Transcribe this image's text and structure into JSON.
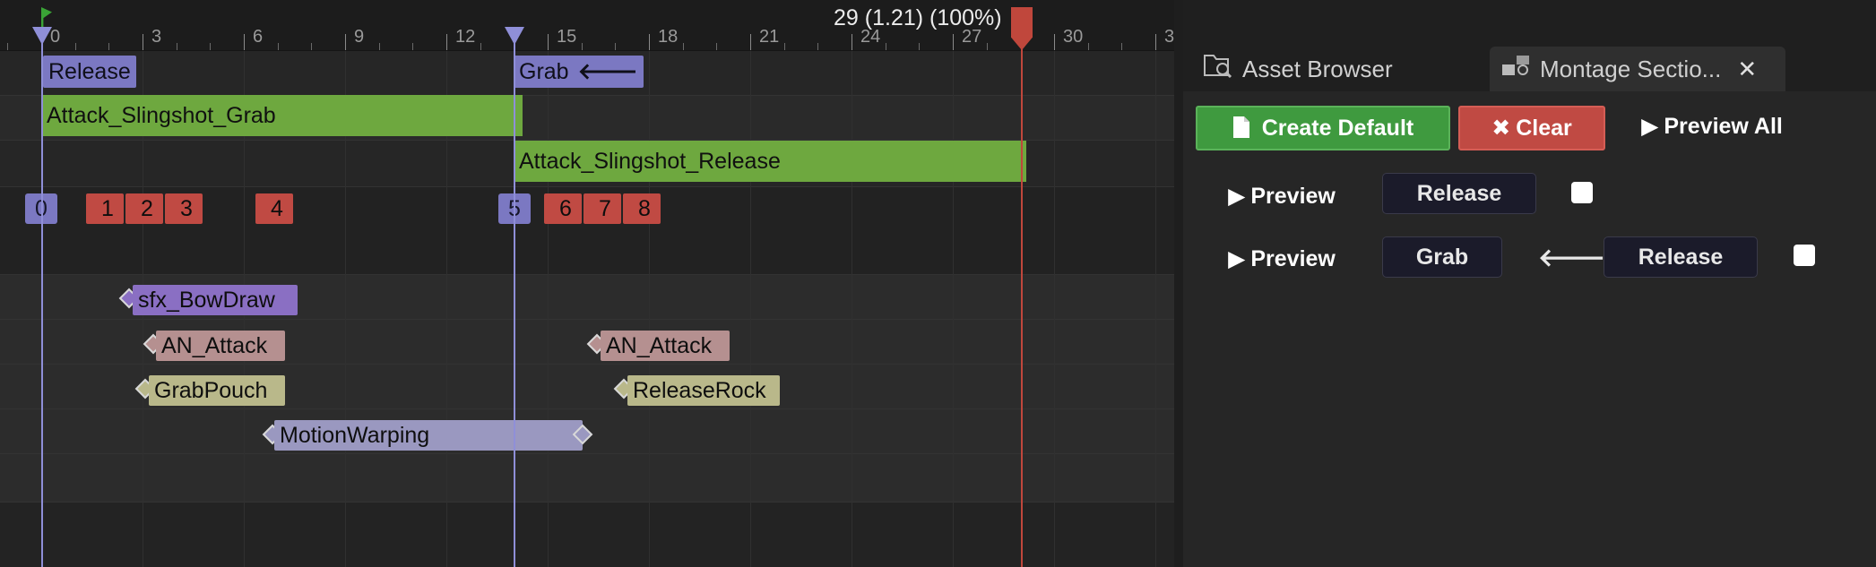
{
  "timeline": {
    "time_readout": "29 (1.21) (100%)",
    "ruler_labels": [
      "0",
      "3",
      "6",
      "9",
      "12",
      "15",
      "18",
      "21",
      "24",
      "27",
      "30",
      "3"
    ],
    "sections": [
      {
        "label": "Release",
        "arrow": ""
      },
      {
        "label": "Grab",
        "arrow": "🡐"
      }
    ],
    "segments": [
      "Attack_Slingshot_Grab",
      "Attack_Slingshot_Release"
    ],
    "slots": [
      {
        "label": "0",
        "kind": "branch"
      },
      {
        "label": "1",
        "kind": "notify"
      },
      {
        "label": "2",
        "kind": "notify"
      },
      {
        "label": "3",
        "kind": "notify"
      },
      {
        "label": "4",
        "kind": "notify"
      },
      {
        "label": "5",
        "kind": "branch"
      },
      {
        "label": "6",
        "kind": "notify"
      },
      {
        "label": "7",
        "kind": "notify"
      },
      {
        "label": "8",
        "kind": "notify"
      }
    ],
    "notifies": [
      {
        "label": "sfx_BowDraw",
        "color": "#8a6fc3"
      },
      {
        "label": "AN_Attack",
        "color": "#b59090"
      },
      {
        "label": "AN_Attack",
        "color": "#b59090"
      },
      {
        "label": "GrabPouch",
        "color": "#b9b88a"
      },
      {
        "label": "ReleaseRock",
        "color": "#b9b88a"
      },
      {
        "label": "MotionWarping",
        "color": "#9a98c0"
      }
    ]
  },
  "panel": {
    "tabs": [
      {
        "label": "Asset Browser",
        "icon": "asset-browser-icon"
      },
      {
        "label": "Montage Sectio...",
        "icon": "montage-sections-icon"
      }
    ],
    "actions": {
      "create_default": "Create Default",
      "clear": "Clear",
      "preview_all": "Preview All"
    },
    "rows": [
      {
        "preview": "Preview",
        "sections": [
          "Release"
        ]
      },
      {
        "preview": "Preview",
        "sections": [
          "Grab",
          "Release"
        ],
        "link": "🡐"
      }
    ]
  },
  "colors": {
    "accent_green": "#3f9a3f",
    "accent_red": "#c04a43",
    "section_purple": "#7b78c2",
    "segment_green": "#6ea83f"
  }
}
